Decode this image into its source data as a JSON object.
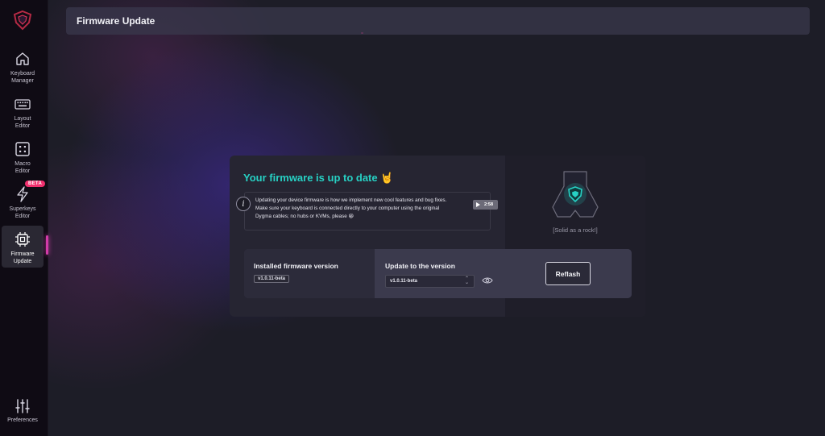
{
  "header": {
    "title": "Firmware Update"
  },
  "sidebar": {
    "items": [
      {
        "id": "keyboard-manager",
        "label_line1": "Keyboard",
        "label_line2": "Manager",
        "icon": "home-icon"
      },
      {
        "id": "layout-editor",
        "label_line1": "Layout",
        "label_line2": "Editor",
        "icon": "keyboard-icon"
      },
      {
        "id": "macro-editor",
        "label_line1": "Macro",
        "label_line2": "Editor",
        "icon": "macro-icon"
      },
      {
        "id": "superkeys-editor",
        "label_line1": "Superkeys",
        "label_line2": "Editor",
        "icon": "bolt-icon",
        "badge": "BETA"
      },
      {
        "id": "firmware-update",
        "label_line1": "Firmware",
        "label_line2": "Update",
        "icon": "chip-icon",
        "active": true
      }
    ],
    "preferences": {
      "label": "Preferences",
      "icon": "sliders-icon"
    }
  },
  "firmware": {
    "status_title": "Your firmware is up to date",
    "status_emoji": "🤘",
    "info_line1": "Updating your device firmware is how we implement new cool features and bug fixes.",
    "info_line2": "Make sure your keyboard is connected directly to your computer using the original",
    "info_line3": "Dygma cables; no hubs or KVMs, please 😀",
    "video_duration": "2:58",
    "installed_label": "Installed firmware version",
    "installed_version": "v1.0.11-beta",
    "update_label": "Update to the version",
    "selected_version": "v1.0.11-beta",
    "reflash_label": "Reflash",
    "device_caption": "[Solid as a rock!]"
  },
  "colors": {
    "accent_teal": "#27d1c4",
    "accent_pink": "#d23ba8",
    "beta_badge": "#f0306e",
    "sidebar_bg": "#0f0b14"
  }
}
